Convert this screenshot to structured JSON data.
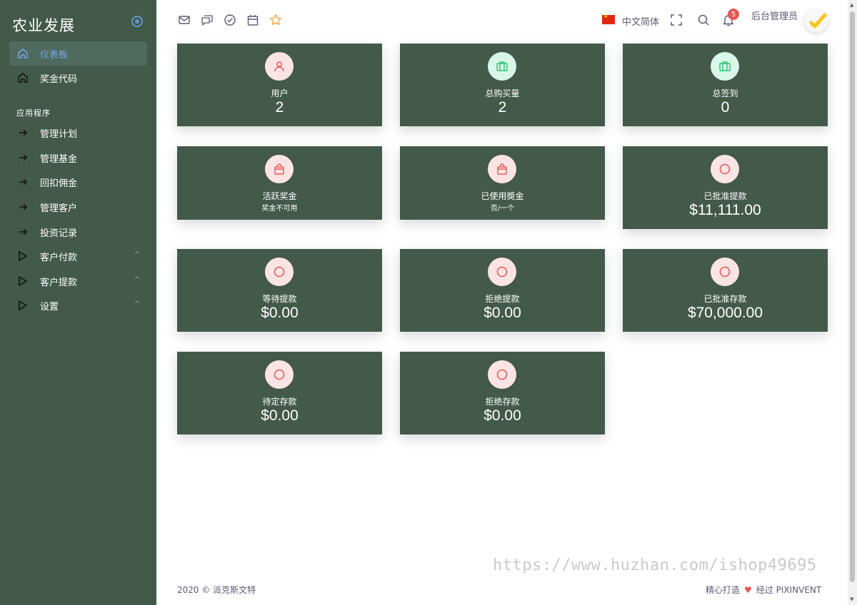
{
  "sidebar": {
    "brand": "农业发展",
    "items": [
      {
        "label": "仪表板",
        "icon": "home-icon"
      },
      {
        "label": "奖金代码",
        "icon": "home-icon"
      }
    ],
    "section_title": "应用程序",
    "app_items": [
      {
        "label": "管理计划",
        "icon": "arrow-right-icon"
      },
      {
        "label": "管理基金",
        "icon": "arrow-right-icon"
      },
      {
        "label": "回扣佣金",
        "icon": "arrow-right-icon"
      },
      {
        "label": "管理客户",
        "icon": "arrow-right-icon"
      },
      {
        "label": "投资记录",
        "icon": "arrow-right-icon"
      },
      {
        "label": "客户付款",
        "icon": "play-icon",
        "chevron": "^"
      },
      {
        "label": "客户提款",
        "icon": "play-icon",
        "chevron": "^"
      },
      {
        "label": "设置",
        "icon": "play-icon",
        "chevron": "^"
      }
    ]
  },
  "header": {
    "language": "中文简体",
    "notifications_count": "5",
    "user_name": "后台管理员"
  },
  "cards": {
    "users": {
      "label": "用户",
      "value": "2"
    },
    "total_purchases": {
      "label": "总购买量",
      "value": "2"
    },
    "total_checkins": {
      "label": "总签到",
      "value": "0"
    },
    "active_bonus": {
      "label": "活跃奖金",
      "sub": "奖金不可用"
    },
    "used_bonus": {
      "label": "已使用奬金",
      "sub": "否/一个"
    },
    "approved_withdrawals": {
      "label": "已批准提款",
      "value": "$11,111.00"
    },
    "pending_withdrawals": {
      "label": "等待提款",
      "value": "$0.00"
    },
    "rejected_withdrawals": {
      "label": "拒绝提款",
      "value": "$0.00"
    },
    "approved_deposits": {
      "label": "已批准存款",
      "value": "$70,000.00"
    },
    "pending_deposits": {
      "label": "待定存款",
      "value": "$0.00"
    },
    "rejected_deposits": {
      "label": "拒绝存款",
      "value": "$0.00"
    }
  },
  "footer": {
    "copyright": "2020 © 派克斯文特",
    "made_with": "精心打造",
    "by": "经过 PIXINVENT"
  },
  "watermark": "https://www.huzhan.com/ishop49695",
  "colors": {
    "sidebar_bg": "#43594a",
    "card_bg": "#43594a",
    "accent": "#7aa7e8",
    "danger": "#ea5455",
    "success_light": "#d9f7e8",
    "danger_light": "#fce4e4"
  }
}
